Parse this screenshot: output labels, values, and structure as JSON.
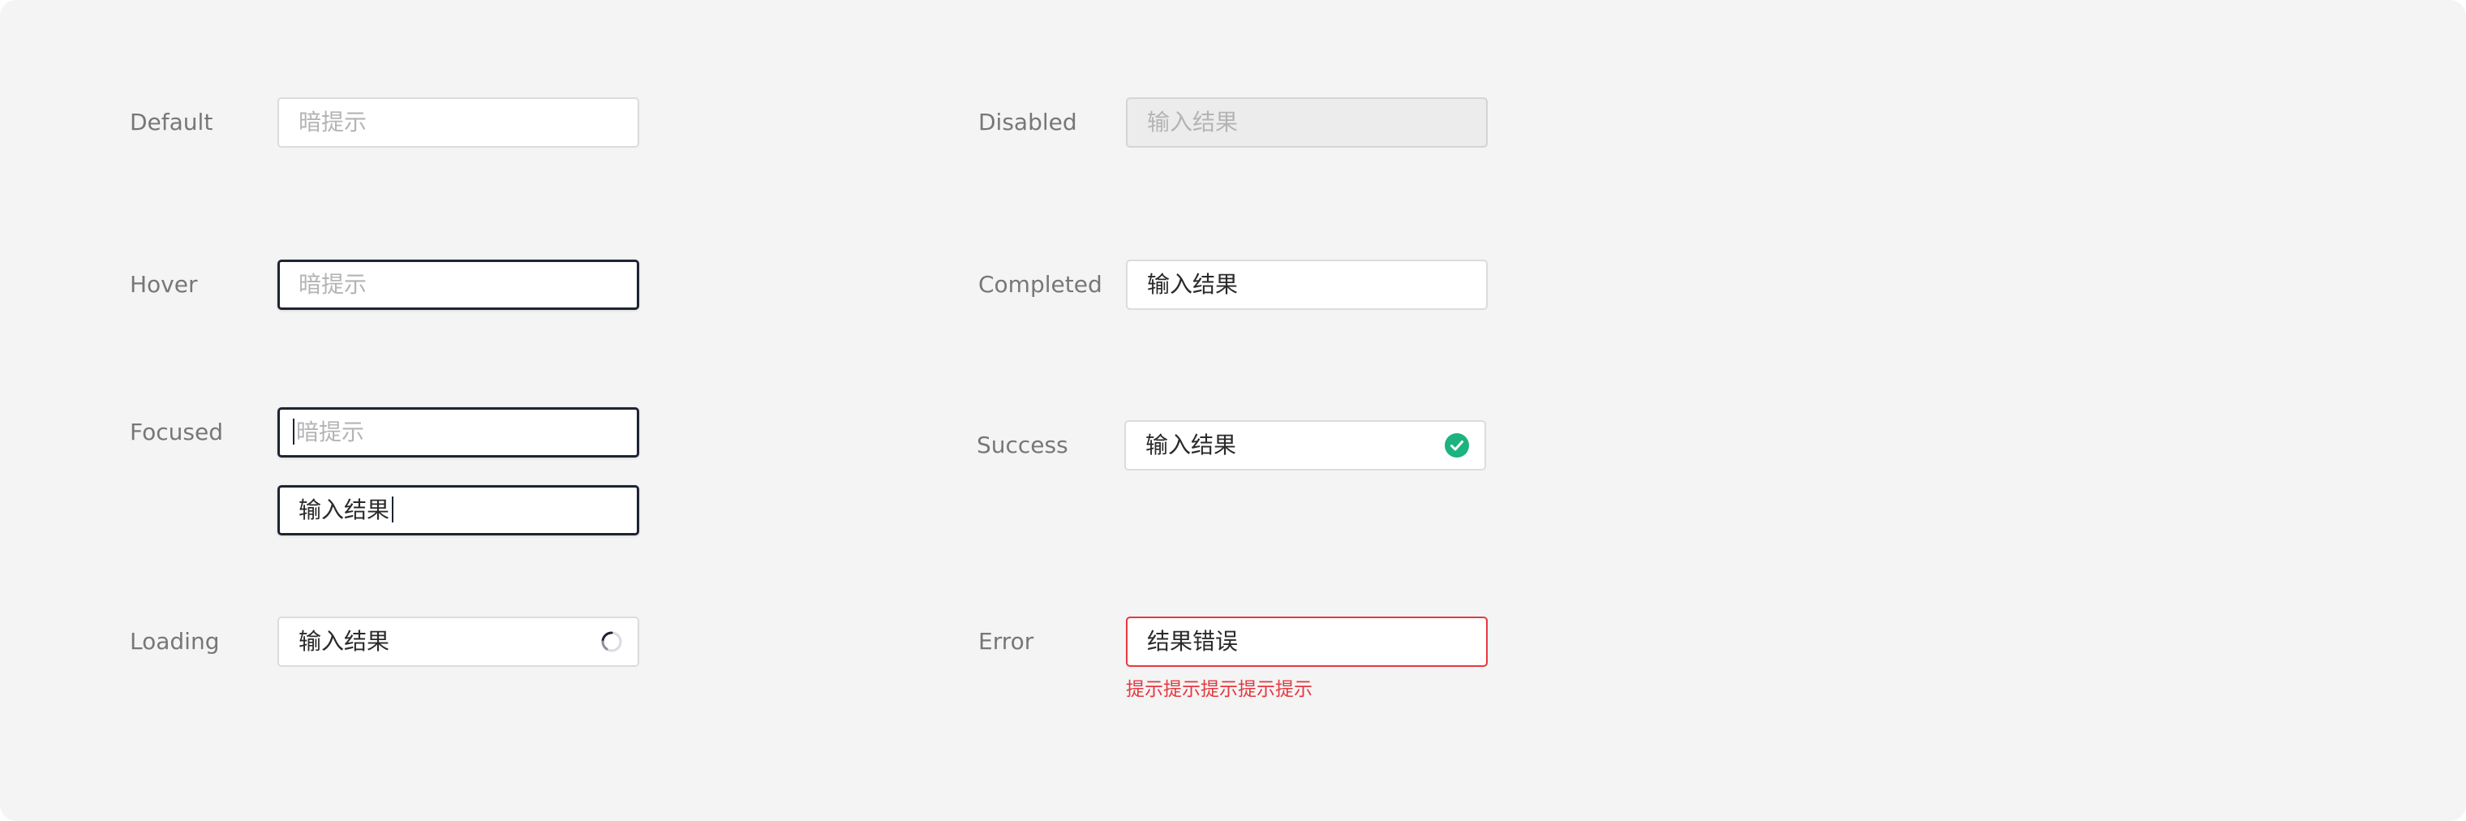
{
  "colors": {
    "background": "#f4f4f4",
    "label": "#777777",
    "border_default": "#dcdcdc",
    "border_active": "#1e2433",
    "placeholder": "#b4b4b4",
    "value": "#2a2a2a",
    "success": "#1bb37e",
    "error": "#e5393f"
  },
  "states": {
    "default": {
      "label": "Default",
      "placeholder": "暗提示"
    },
    "hover": {
      "label": "Hover",
      "placeholder": "暗提示"
    },
    "focused": {
      "label": "Focused",
      "empty_placeholder": "暗提示",
      "filled_value": "输入结果"
    },
    "loading": {
      "label": "Loading",
      "value": "输入结果",
      "icon": "loading-spinner-icon"
    },
    "disabled": {
      "label": "Disabled",
      "value": "输入结果"
    },
    "completed": {
      "label": "Completed",
      "value": "输入结果"
    },
    "success": {
      "label": "Success",
      "value": "输入结果",
      "icon": "check-circle-icon"
    },
    "error": {
      "label": "Error",
      "value": "结果错误",
      "hint": "提示提示提示提示提示"
    }
  }
}
